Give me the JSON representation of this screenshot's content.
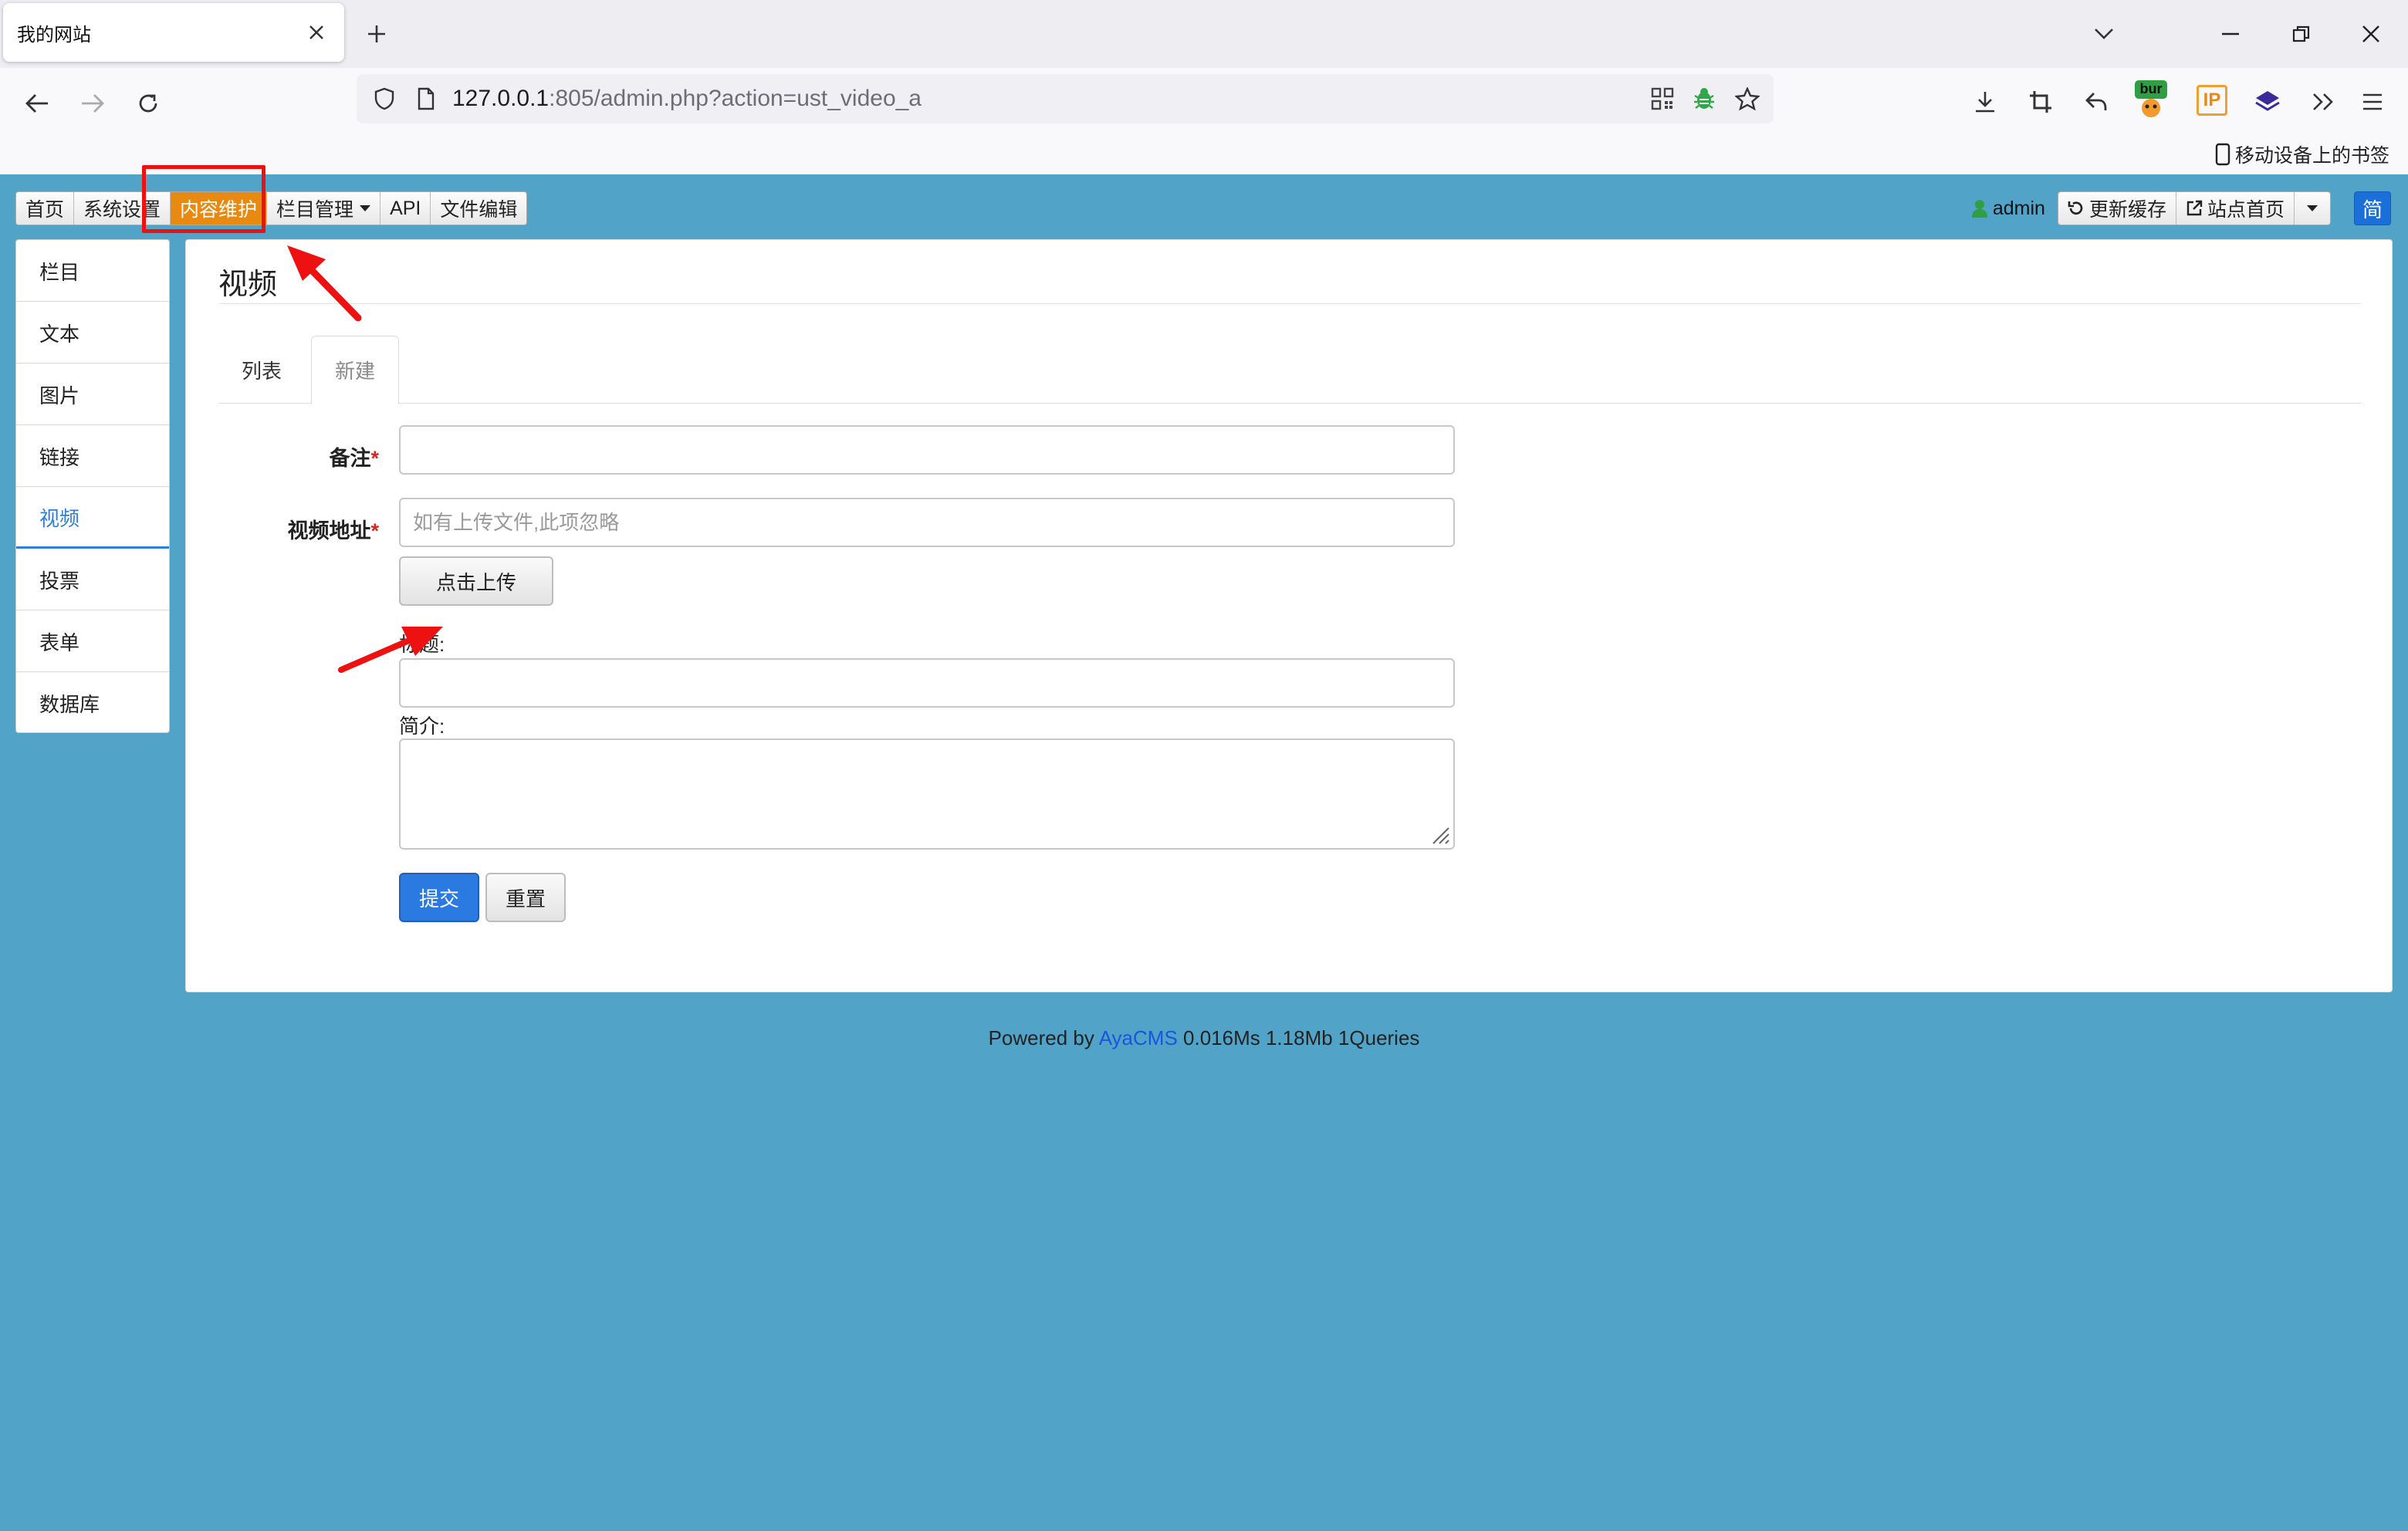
{
  "browser": {
    "tab_title": "我的网站",
    "url_host": "127.0.0.1",
    "url_rest": ":805/admin.php?action=ust_video_a",
    "ext_bur_label": "bur",
    "ext_ip_label": "IP",
    "bookmark_mobile": "移动设备上的书签"
  },
  "topnav": {
    "items": [
      {
        "label": "首页"
      },
      {
        "label": "系统设置"
      },
      {
        "label": "内容维护"
      },
      {
        "label": "栏目管理"
      },
      {
        "label": "API"
      },
      {
        "label": "文件编辑"
      }
    ],
    "user": "admin",
    "refresh_cache": "更新缓存",
    "site_home": "站点首页",
    "lang": "简"
  },
  "sidebar": {
    "items": [
      {
        "label": "栏目"
      },
      {
        "label": "文本"
      },
      {
        "label": "图片"
      },
      {
        "label": "链接"
      },
      {
        "label": "视频"
      },
      {
        "label": "投票"
      },
      {
        "label": "表单"
      },
      {
        "label": "数据库"
      }
    ]
  },
  "main": {
    "title": "视频",
    "tabs": [
      {
        "label": "列表"
      },
      {
        "label": "新建"
      }
    ],
    "form": {
      "remark_label": "备注",
      "video_url_label": "视频地址",
      "video_url_placeholder": "如有上传文件,此项忽略",
      "upload_label": "点击上传",
      "title_label": "标题:",
      "intro_label": "简介:",
      "required_mark": "*",
      "submit_label": "提交",
      "reset_label": "重置"
    }
  },
  "footer": {
    "prefix": "Powered by",
    "link": "AyaCMS",
    "stats": "0.016Ms 1.18Mb 1Queries"
  },
  "colors": {
    "page_bg": "#52a3c8",
    "active_nav": "#e88a12",
    "primary": "#2a7ae2",
    "annotation": "#e11111"
  }
}
